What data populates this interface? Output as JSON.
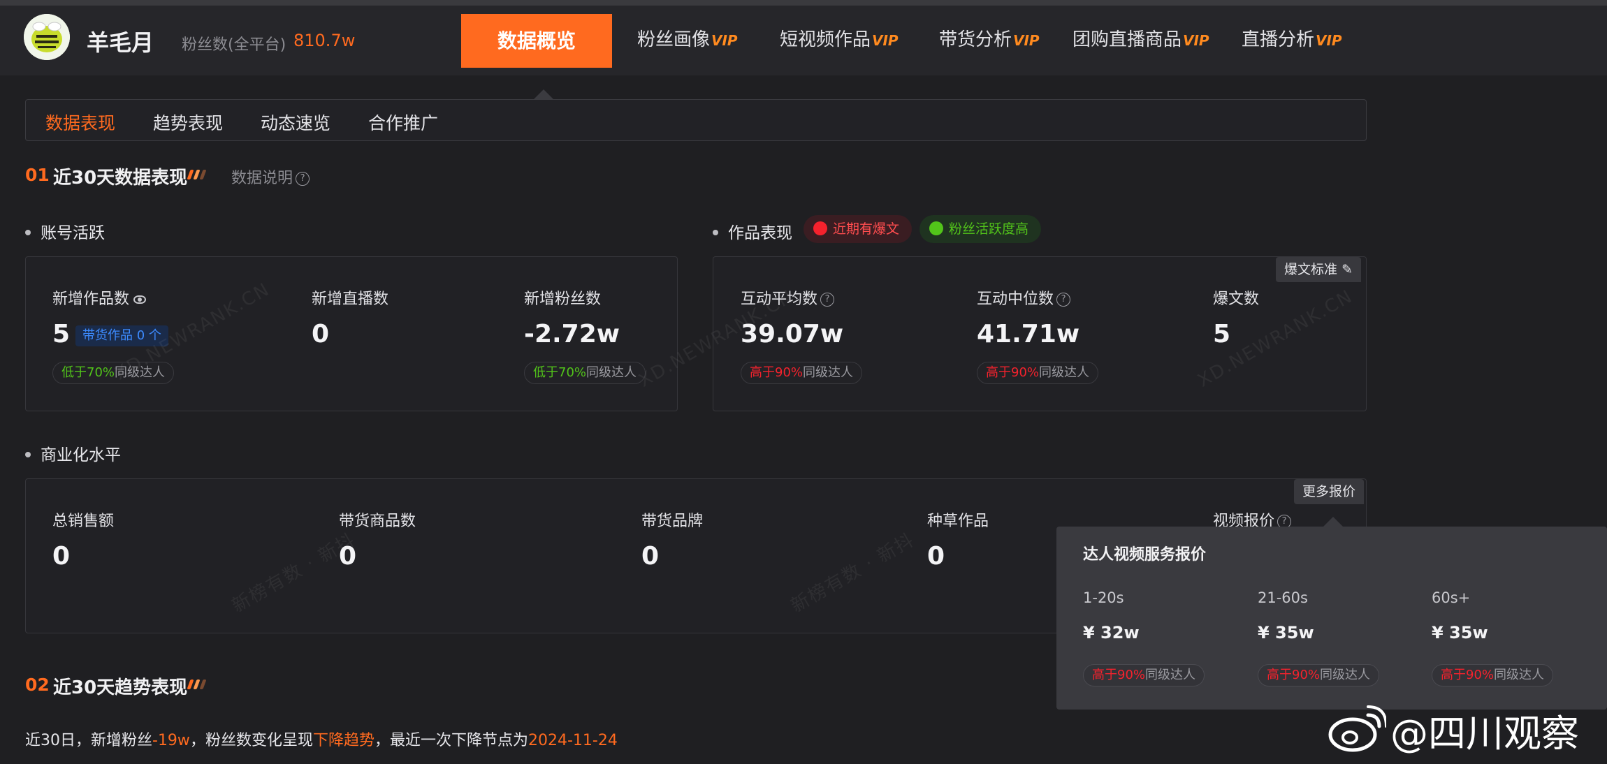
{
  "header": {
    "account_name": "羊毛月",
    "fans_label": "粉丝数(全平台)",
    "fans_value": "810.7w",
    "nav": [
      {
        "label": "数据概览",
        "vip": ""
      },
      {
        "label": "粉丝画像",
        "vip": "VIP"
      },
      {
        "label": "短视频作品",
        "vip": "VIP"
      },
      {
        "label": "带货分析",
        "vip": "VIP"
      },
      {
        "label": "团购直播商品",
        "vip": "VIP"
      },
      {
        "label": "直播分析",
        "vip": "VIP"
      }
    ]
  },
  "subtabs": [
    "数据表现",
    "趋势表现",
    "动态速览",
    "合作推广"
  ],
  "section1": {
    "num": "01",
    "title": "近30天数据表现",
    "explain": "数据说明",
    "activity": {
      "title": "账号活跃",
      "metrics": [
        {
          "label": "新增作品数",
          "value": "5",
          "goods_tag": "带货作品 0 个",
          "compare_pct": "低于70%",
          "compare_suffix": "同级达人"
        },
        {
          "label": "新增直播数",
          "value": "0"
        },
        {
          "label": "新增粉丝数",
          "value": "-2.72w",
          "compare_pct": "低于70%",
          "compare_suffix": "同级达人"
        }
      ]
    },
    "works": {
      "title": "作品表现",
      "tags": [
        "近期有爆文",
        "粉丝活跃度高"
      ],
      "corner_button": "爆文标准",
      "metrics": [
        {
          "label": "互动平均数",
          "value": "39.07w",
          "compare_pct": "高于90%",
          "compare_suffix": "同级达人"
        },
        {
          "label": "互动中位数",
          "value": "41.71w",
          "compare_pct": "高于90%",
          "compare_suffix": "同级达人"
        },
        {
          "label": "爆文数",
          "value": "5"
        }
      ]
    },
    "commerce": {
      "title": "商业化水平",
      "corner_button": "更多报价",
      "metrics": [
        {
          "label": "总销售额",
          "value": "0"
        },
        {
          "label": "带货商品数",
          "value": "0"
        },
        {
          "label": "带货品牌",
          "value": "0"
        },
        {
          "label": "种草作品",
          "value": "0"
        },
        {
          "label": "视频报价",
          "value": ""
        }
      ]
    }
  },
  "popover": {
    "title": "达人视频服务报价",
    "items": [
      {
        "range": "1-20s",
        "price": "¥ 32w",
        "compare_pct": "高于90%",
        "compare_suffix": "同级达人"
      },
      {
        "range": "21-60s",
        "price": "¥ 35w",
        "compare_pct": "高于90%",
        "compare_suffix": "同级达人"
      },
      {
        "range": "60s+",
        "price": "¥ 35w",
        "compare_pct": "高于90%",
        "compare_suffix": "同级达人"
      }
    ]
  },
  "section2": {
    "num": "02",
    "title": "近30天趋势表现",
    "trend": {
      "p1": "近30日，新增粉丝",
      "fans_change": "-19w",
      "p2": "，粉丝数变化呈现",
      "trend_word": "下降趋势",
      "p3": "，最近一次下降节点为",
      "date": "2024-11-24"
    }
  },
  "watermarks": [
    "XD.NEWRANK.CN",
    "XD.NEWRANK.CN",
    "XD.NEWRANK.CN",
    "新榜有数 · 新抖",
    "新榜有数 · 新抖"
  ],
  "footer_watermark": "@四川观察",
  "colors": {
    "accent": "#ff6a1f",
    "low": "#52c41a",
    "high": "#f5222d",
    "vip": "#ff8a1f"
  },
  "icons": [
    "avatar-bee",
    "question-icon",
    "eye-icon",
    "fire-icon",
    "user-icon",
    "edit-icon",
    "weibo-logo"
  ]
}
